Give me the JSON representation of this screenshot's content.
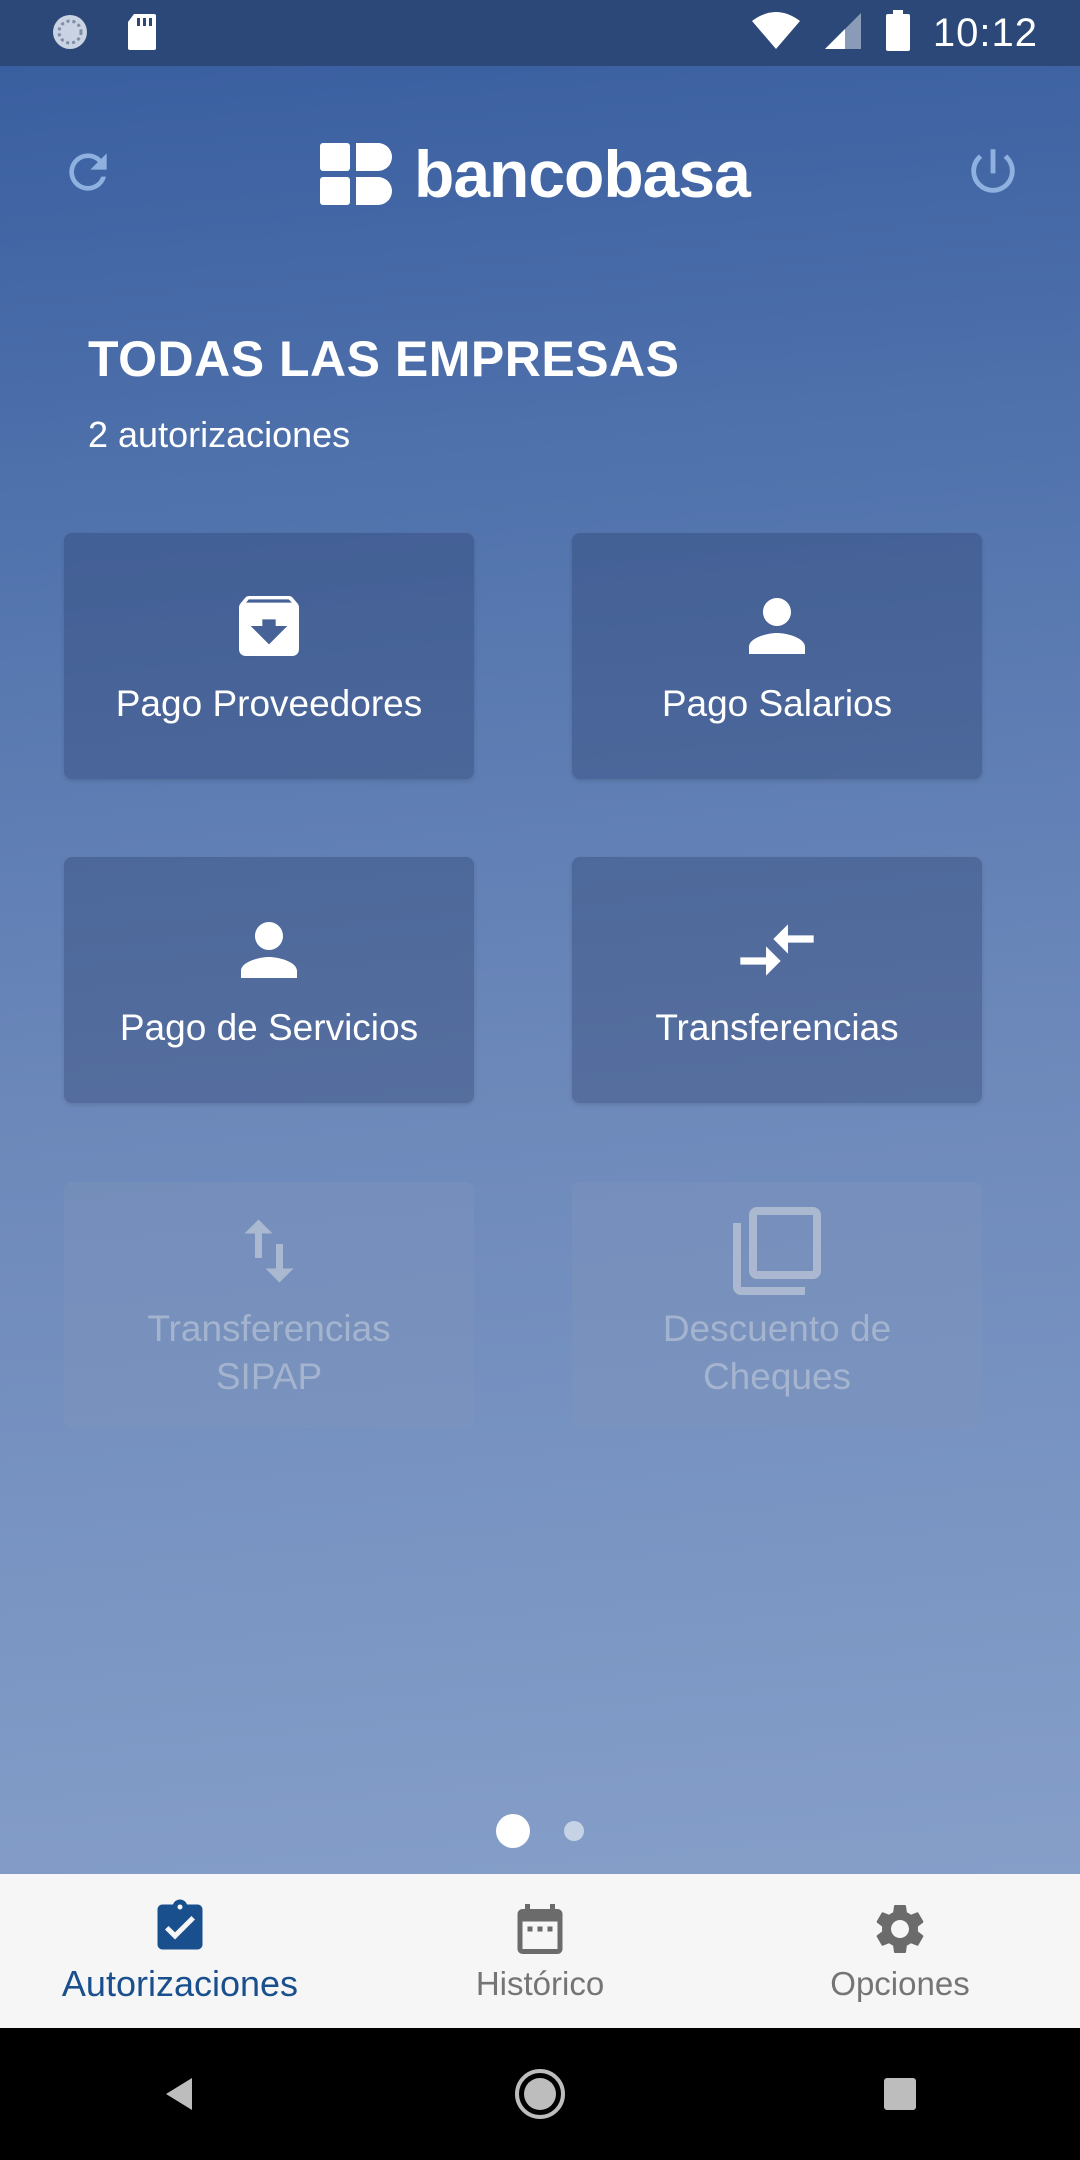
{
  "status_bar": {
    "time": "10:12"
  },
  "header": {
    "logo_bold": "bancobasa",
    "logo_icon": "bb-logo-icon",
    "refresh_icon": "refresh-icon",
    "power_icon": "power-icon"
  },
  "main": {
    "title": "TODAS LAS EMPRESAS",
    "subtitle": "2 autorizaciones",
    "tiles": [
      {
        "label": "Pago Proveedores",
        "icon": "archive-icon",
        "enabled": true
      },
      {
        "label": "Pago Salarios",
        "icon": "person-icon",
        "enabled": true
      },
      {
        "label": "Pago de Servicios",
        "icon": "person-icon",
        "enabled": true
      },
      {
        "label": "Transferencias",
        "icon": "compare-arrows-icon",
        "enabled": true
      },
      {
        "label_line1": "Transferencias",
        "label_line2": "SIPAP",
        "icon": "swap-vert-icon",
        "enabled": false
      },
      {
        "label_line1": "Descuento de",
        "label_line2": "Cheques",
        "icon": "copy-icon",
        "enabled": false
      }
    ]
  },
  "pager": {
    "pages": 2,
    "current": 1
  },
  "bottom_nav": {
    "items": [
      {
        "label": "Autorizaciones",
        "icon": "clipboard-check-icon",
        "active": true
      },
      {
        "label": "Histórico",
        "icon": "calendar-icon",
        "active": false
      },
      {
        "label": "Opciones",
        "icon": "gear-icon",
        "active": false
      }
    ]
  },
  "colors": {
    "accent": "#1a4f8e",
    "status_bar": "#2c4878",
    "nav_background": "#f6f6f6"
  }
}
